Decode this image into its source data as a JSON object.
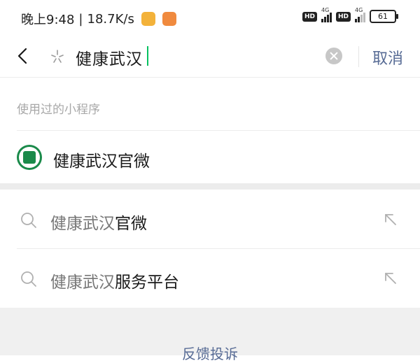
{
  "status_bar": {
    "time_text": "晚上9:48",
    "separator": "|",
    "speed_text": "18.7K/s",
    "hd_1": "HD",
    "hd_2": "HD",
    "network_1": "4G",
    "network_2": "4G",
    "battery": "61"
  },
  "search": {
    "query": "健康武汉",
    "cancel_label": "取消"
  },
  "recent_mini_programs": {
    "section_label": "使用过的小程序",
    "items": [
      {
        "name": "健康武汉官微"
      }
    ]
  },
  "suggestions": [
    {
      "highlight": "健康武汉",
      "rest": "官微"
    },
    {
      "highlight": "健康武汉",
      "rest": "服务平台"
    }
  ],
  "footer": {
    "feedback_label": "反馈投诉"
  },
  "colors": {
    "accent_link": "#576b95",
    "caret": "#07c160",
    "mini_logo": "#1a8a4a"
  },
  "icons": [
    "back-arrow-icon",
    "star-icon",
    "clear-icon",
    "search-icon",
    "fill-query-icon"
  ]
}
